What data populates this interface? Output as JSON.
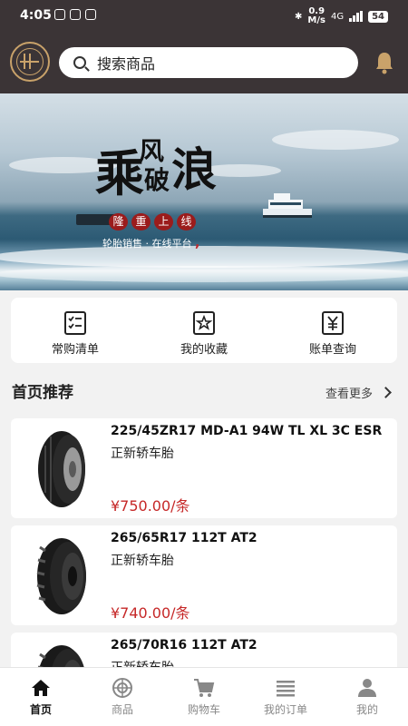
{
  "status": {
    "time": "4:05",
    "speed_value": "0.9",
    "speed_unit": "M/s",
    "network": "4G",
    "battery": "54"
  },
  "search": {
    "placeholder": "搜索商品"
  },
  "banner": {
    "title_chars": [
      "乘",
      "风",
      "破",
      "浪"
    ],
    "launch_chars": [
      "隆",
      "重",
      "上",
      "线"
    ],
    "tagline": "轮胎销售 · 在线平台"
  },
  "quick": [
    {
      "label": "常购清单",
      "icon": "checklist-icon"
    },
    {
      "label": "我的收藏",
      "icon": "favorite-star-icon"
    },
    {
      "label": "账单查询",
      "icon": "bill-yen-icon"
    }
  ],
  "section": {
    "title": "首页推荐",
    "more": "查看更多"
  },
  "products": [
    {
      "name": "225/45ZR17 MD-A1 94W TL XL 3C ESR",
      "category": "正新轿车胎",
      "price": "¥750.00/条"
    },
    {
      "name": "265/65R17 112T AT2",
      "category": "正新轿车胎",
      "price": "¥740.00/条"
    },
    {
      "name": "265/70R16 112T AT2",
      "category": "正新轿车胎",
      "price": ""
    }
  ],
  "tabs": [
    {
      "label": "首页",
      "icon": "home-icon",
      "active": true
    },
    {
      "label": "商品",
      "icon": "tire-wheel-icon",
      "active": false
    },
    {
      "label": "购物车",
      "icon": "cart-icon",
      "active": false
    },
    {
      "label": "我的订单",
      "icon": "order-list-icon",
      "active": false
    },
    {
      "label": "我的",
      "icon": "user-icon",
      "active": false
    }
  ],
  "colors": {
    "header": "#3b3436",
    "accent_gold": "#c9a26a",
    "price_red": "#c62828",
    "seal_red": "#9b1c1c"
  }
}
